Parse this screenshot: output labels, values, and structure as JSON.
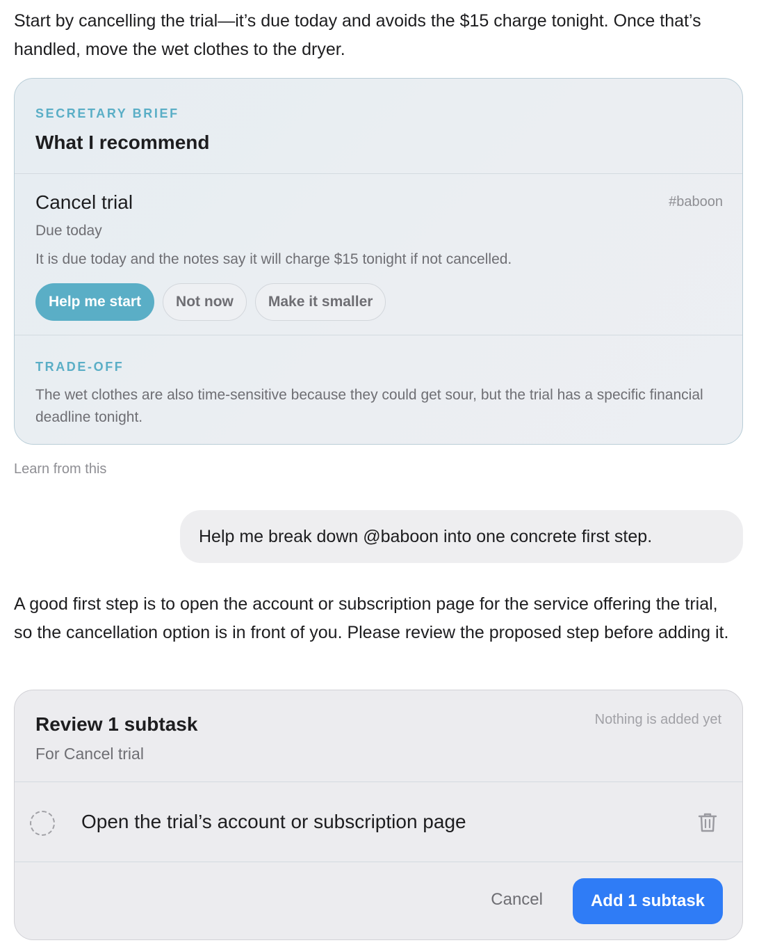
{
  "intro": {
    "text": "Start by cancelling the trial—it’s due today and avoids the $15 charge tonight. Once that’s handled, move the wet clothes to the dryer."
  },
  "brief": {
    "eyebrow": "SECRETARY BRIEF",
    "title": "What I recommend",
    "task": {
      "title": "Cancel trial",
      "tag": "#baboon",
      "due": "Due today",
      "reason": "It is due today and the notes say it will charge $15 tonight if not cancelled."
    },
    "buttons": {
      "help": "Help me start",
      "not_now": "Not now",
      "smaller": "Make it smaller"
    },
    "tradeoff": {
      "eyebrow": "TRADE-OFF",
      "text": "The wet clothes are also time-sensitive because they could get sour, but the trial has a specific financial deadline tonight."
    }
  },
  "learn_link": "Learn from this",
  "user_message": "Help me break down @baboon into one concrete first step.",
  "reply": {
    "text": "A good first step is to open the account or subscription page for the service offering the trial, so the cancellation option is in front of you. Please review the proposed step before adding it."
  },
  "review": {
    "title": "Review 1 subtask",
    "status": "Nothing is added yet",
    "subtitle": "For Cancel trial",
    "subtasks": [
      {
        "label": "Open the trial’s account or subscription page",
        "icon": "trash-icon"
      }
    ],
    "cancel_label": "Cancel",
    "add_label": "Add 1 subtask"
  },
  "colors": {
    "accent_teal": "#5aaec6",
    "primary_blue": "#2f7cf6"
  }
}
